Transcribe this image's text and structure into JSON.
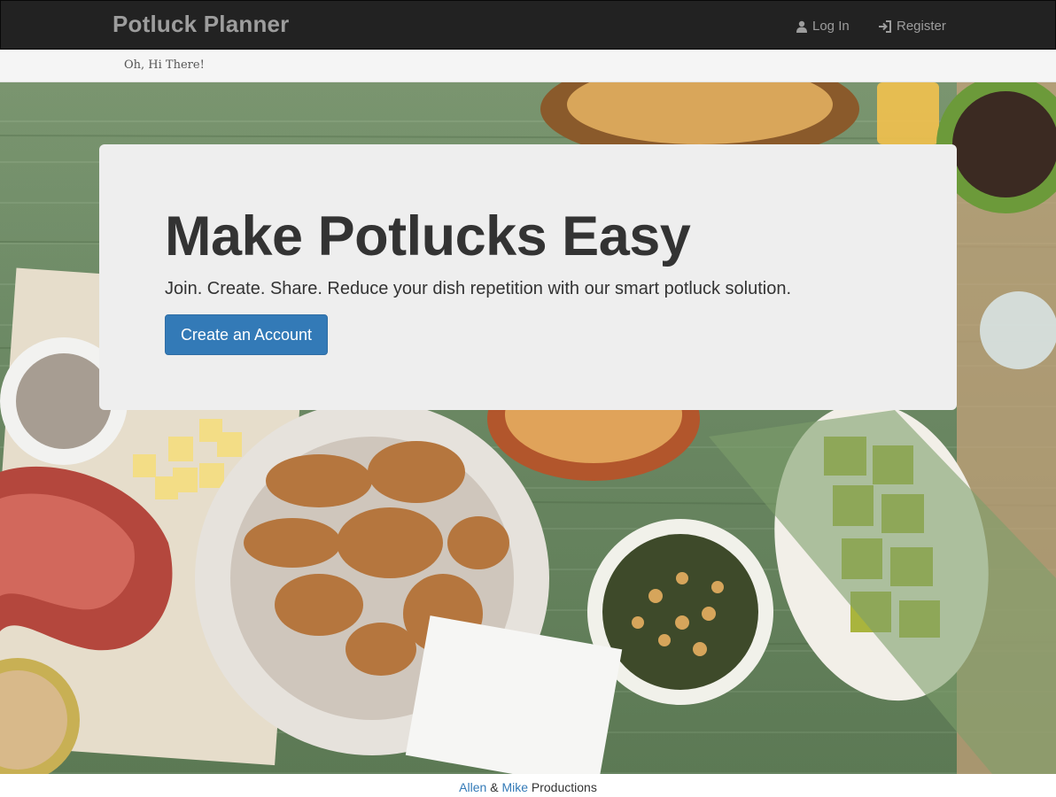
{
  "navbar": {
    "brand": "Potluck Planner",
    "login_label": "Log In",
    "register_label": "Register"
  },
  "subbar": {
    "greeting": "Oh, Hi There!"
  },
  "jumbotron": {
    "title": "Make Potlucks Easy",
    "subtitle": "Join. Create. Share. Reduce your dish repetition with our smart potluck solution.",
    "cta_label": "Create an Account"
  },
  "footer": {
    "author1": "Allen",
    "separator": " & ",
    "author2": "Mike",
    "suffix": " Productions"
  },
  "colors": {
    "navbar_bg": "#222222",
    "primary": "#337ab7",
    "jumbotron_bg": "#eeeeee"
  },
  "icons": {
    "login": "user-icon",
    "register": "log-in-icon"
  }
}
